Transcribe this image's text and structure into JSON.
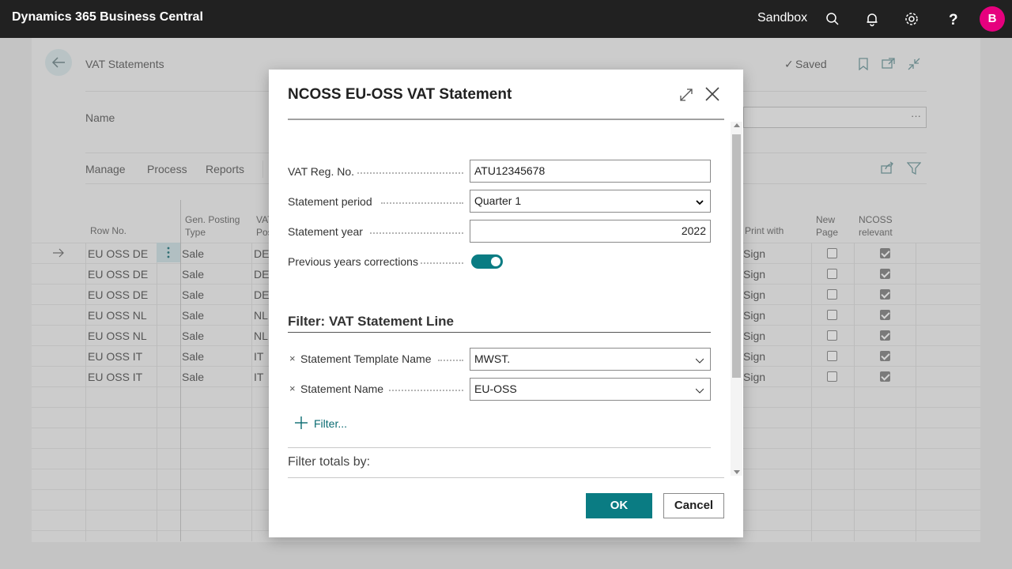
{
  "app": {
    "title": "Dynamics 365 Business Central",
    "environment": "Sandbox",
    "avatar_initial": "B",
    "brand_color": "#e6007e",
    "accent_color": "#0a7c83"
  },
  "background_page": {
    "title": "VAT Statements",
    "saved_status": "Saved",
    "name_label": "Name",
    "name_value_menu": "···",
    "actions": [
      "Manage",
      "Process",
      "Reports"
    ],
    "columns": {
      "row_no": "Row No.",
      "gen_posting_type_1": "Gen. Posting",
      "gen_posting_type_2": "Type",
      "vat_1": "VAT",
      "vat_2": "Pos",
      "print_with": "Print with",
      "new_page_1": "New",
      "new_page_2": "Page",
      "ncoss_1": "NCOSS",
      "ncoss_2": "relevant"
    },
    "rows": [
      {
        "row_no": "EU OSS DE",
        "type": "Sale",
        "vat": "DE",
        "print_with": "Sign",
        "new_page": false,
        "ncoss": true
      },
      {
        "row_no": "EU OSS DE",
        "type": "Sale",
        "vat": "DE",
        "print_with": "Sign",
        "new_page": false,
        "ncoss": true
      },
      {
        "row_no": "EU OSS DE",
        "type": "Sale",
        "vat": "DE",
        "print_with": "Sign",
        "new_page": false,
        "ncoss": true
      },
      {
        "row_no": "EU OSS NL",
        "type": "Sale",
        "vat": "NL",
        "print_with": "Sign",
        "new_page": false,
        "ncoss": true
      },
      {
        "row_no": "EU OSS NL",
        "type": "Sale",
        "vat": "NL",
        "print_with": "Sign",
        "new_page": false,
        "ncoss": true
      },
      {
        "row_no": "EU OSS IT",
        "type": "Sale",
        "vat": "IT",
        "print_with": "Sign",
        "new_page": false,
        "ncoss": true
      },
      {
        "row_no": "EU OSS IT",
        "type": "Sale",
        "vat": "IT",
        "print_with": "Sign",
        "new_page": false,
        "ncoss": true
      }
    ]
  },
  "dialog": {
    "title": "NCOSS EU-OSS VAT Statement",
    "fields": {
      "vat_reg_no_label": "VAT Reg. No.",
      "vat_reg_no_value": "ATU12345678",
      "statement_period_label": "Statement period",
      "statement_period_value": "Quarter 1",
      "statement_year_label": "Statement year",
      "statement_year_value": "2022",
      "prev_years_label": "Previous years corrections",
      "prev_years_value": true
    },
    "filter_section_title": "Filter: VAT Statement Line",
    "filters": [
      {
        "label": "Statement Template Name",
        "value": "MWST."
      },
      {
        "label": "Statement Name",
        "value": "EU-OSS"
      }
    ],
    "filter_remove_glyph": "×",
    "add_filter_label": "Filter...",
    "totals_label": "Filter totals by:",
    "ok_label": "OK",
    "cancel_label": "Cancel"
  }
}
